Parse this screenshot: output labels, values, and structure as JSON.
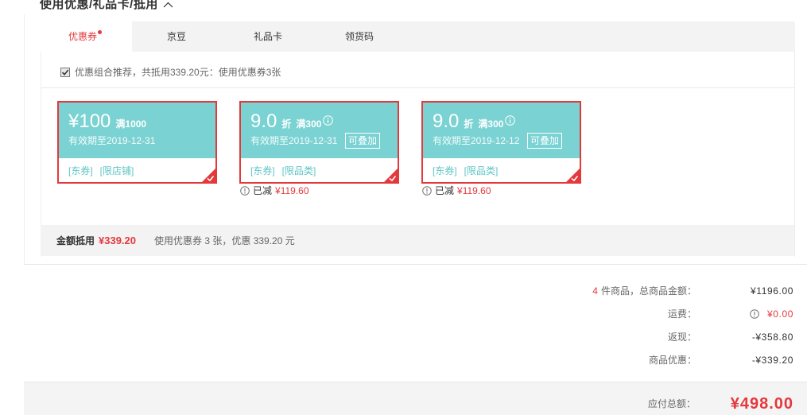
{
  "section": {
    "title": "使用优惠/礼品卡/抵用",
    "toggle_icon": "chevron-up-icon"
  },
  "tabs": [
    {
      "label": "优惠券",
      "active": true,
      "has_dot": true
    },
    {
      "label": "京豆",
      "active": false,
      "has_dot": false
    },
    {
      "label": "礼品卡",
      "active": false,
      "has_dot": false
    },
    {
      "label": "领货码",
      "active": false,
      "has_dot": false
    }
  ],
  "recommend": {
    "checked": true,
    "text": "优惠组合推荐，共抵用339.20元：使用优惠券3张"
  },
  "coupons": [
    {
      "value": "¥100",
      "condition": "满1000",
      "expiry": "有效期至2019-12-31",
      "tags": [
        "[东券]",
        "[限店铺]"
      ],
      "selected": true,
      "check_icon": "corner-check-icon"
    },
    {
      "value": "9.0",
      "unit": "折",
      "condition": "满300",
      "info_icon": "info-icon",
      "expiry": "有效期至2019-12-31",
      "stackable": "可叠加",
      "tags": [
        "[东券]",
        "[限品类]"
      ],
      "selected": true,
      "check_icon": "corner-check-icon",
      "deducted": {
        "icon": "alert-icon",
        "label": "已减",
        "amount": "¥119.60"
      }
    },
    {
      "value": "9.0",
      "unit": "折",
      "condition": "满300",
      "info_icon": "info-icon",
      "expiry": "有效期至2019-12-12",
      "stackable": "可叠加",
      "tags": [
        "[东券]",
        "[限品类]"
      ],
      "selected": true,
      "check_icon": "corner-check-icon",
      "deducted": {
        "icon": "alert-icon",
        "label": "已减",
        "amount": "¥119.60"
      }
    }
  ],
  "footer_bar": {
    "label": "金额抵用",
    "amount": "¥339.20",
    "detail": "使用优惠券 3 张，优惠 339.20 元"
  },
  "summary": {
    "items_count": "4",
    "rows": [
      {
        "label": "件商品，总商品金额：",
        "value": "¥1196.00"
      },
      {
        "label": "运费：",
        "value": "¥0.00",
        "icon": "alert-icon"
      },
      {
        "label": "返现：",
        "value": "-¥358.80"
      },
      {
        "label": "商品优惠：",
        "value": "-¥339.20"
      }
    ]
  },
  "total": {
    "label": "应付总额：",
    "amount": "¥498.00"
  },
  "colors": {
    "accent": "#e4393c",
    "coupon": "#7ad2d3",
    "tag": "#5fc5c7"
  }
}
